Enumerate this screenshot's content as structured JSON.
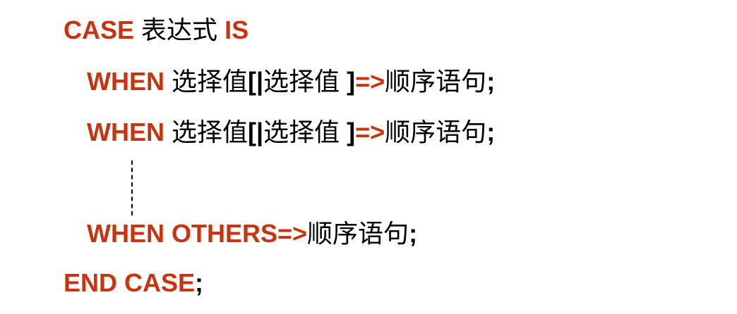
{
  "colors": {
    "keyword": "#c8340f",
    "text": "#000000",
    "background": "#ffffff"
  },
  "syntax": {
    "line1": {
      "kw_case": "CASE",
      "expr": "表达式",
      "kw_is": "IS"
    },
    "when1": {
      "kw_when": "WHEN",
      "value": "选择值",
      "bracket_open": "[|",
      "value2": "选择值",
      "bracket_close": "]",
      "arrow": "=>",
      "stmt": "顺序语句",
      "semicolon": ";"
    },
    "when2": {
      "kw_when": "WHEN",
      "value": "选择值",
      "bracket_open": "[|",
      "value2": "选择值",
      "bracket_close": "]",
      "arrow": "=>",
      "stmt": "顺序语句",
      "semicolon": ";"
    },
    "when_others": {
      "kw": "WHEN OTHERS=>",
      "stmt": "顺序语句",
      "semicolon": ";"
    },
    "end": {
      "kw": "END CASE",
      "semicolon": ";"
    }
  }
}
